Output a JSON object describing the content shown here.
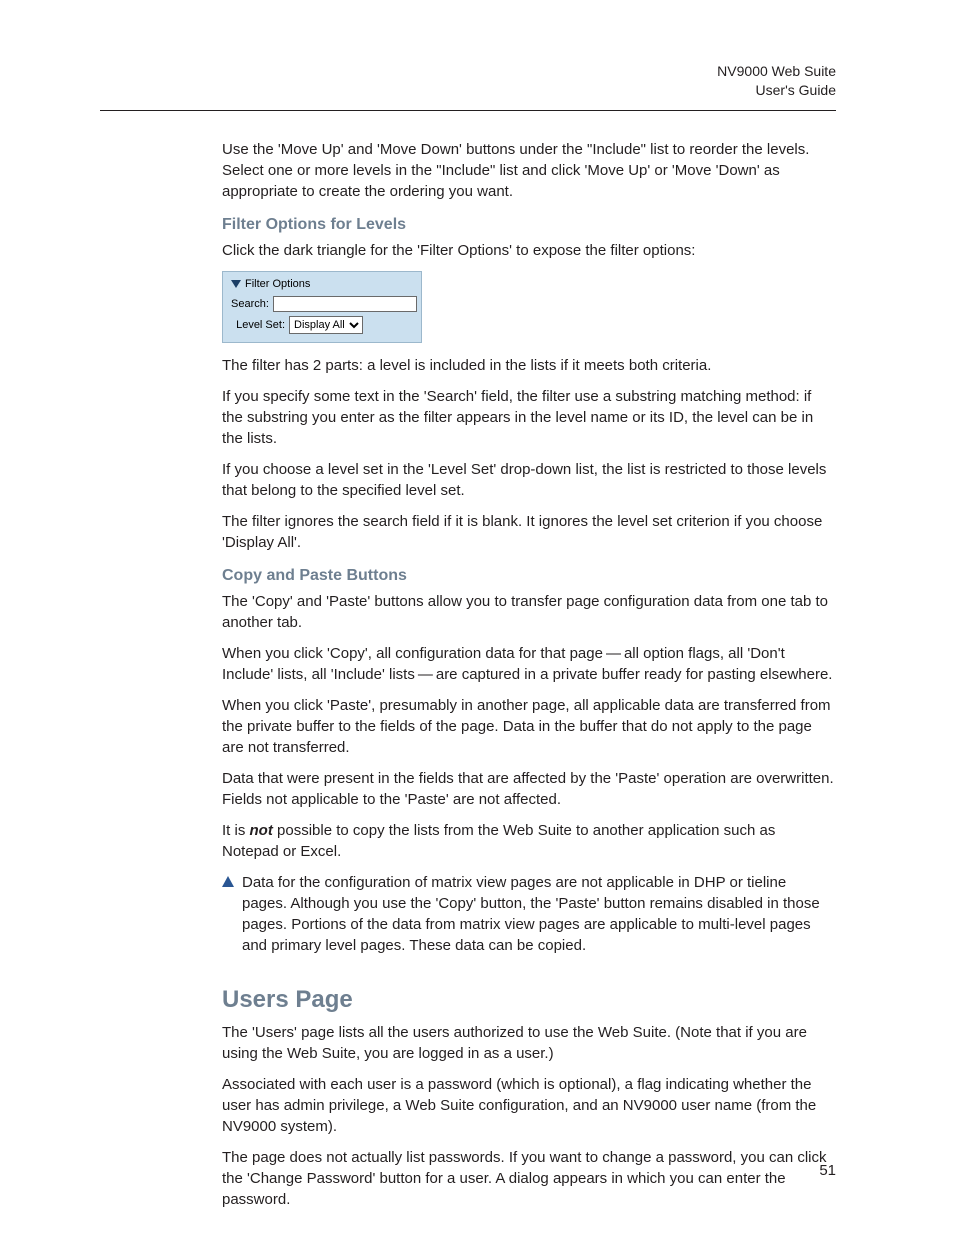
{
  "header": {
    "title": "NV9000 Web Suite",
    "subtitle": "User's Guide"
  },
  "intro_p": "Use the 'Move Up' and 'Move Down' buttons under the \"Include\" list to reorder the levels. Select one or more levels in the \"Include\" list and click 'Move Up' or 'Move 'Down' as appropriate to create the ordering you want.",
  "filter": {
    "heading": "Filter Options for Levels",
    "p1": "Click the dark triangle for the 'Filter Options' to expose the filter options:",
    "panel": {
      "title": "Filter Options",
      "search_label": "Search:",
      "levelset_label": "Level Set:",
      "levelset_value": "Display All"
    },
    "p2": "The filter has 2 parts: a level is included in the lists if it meets both criteria.",
    "p3": "If you specify some text in the 'Search' field, the filter use a substring matching method: if the substring you enter as the filter appears in the level name or its ID, the level can be in the lists.",
    "p4": "If you choose a level set in the 'Level Set' drop-down list, the list is restricted to those levels that belong to the specified level set.",
    "p5": "The filter ignores the search field if it is blank. It ignores the level set criterion if you choose 'Display All'."
  },
  "copy": {
    "heading": "Copy and Paste Buttons",
    "p1": "The 'Copy' and 'Paste' buttons allow you to transfer page configuration data from one tab to another tab.",
    "p2": "When you click 'Copy', all configuration data for that page — all option flags, all 'Don't Include' lists, all 'Include' lists — are captured in a private buffer ready for pasting elsewhere.",
    "p3": "When you click 'Paste', presumably in another page, all applicable data are transferred from the private buffer to the fields of the page. Data in the buffer that do not apply to the page are not transferred.",
    "p4": "Data that were present in the fields that are affected by the 'Paste' operation are overwritten. Fields not applicable to the 'Paste' are not affected.",
    "p5_pre": "It is ",
    "p5_em": "not",
    "p5_post": " possible to copy the lists from the Web Suite to another application such as Notepad or Excel.",
    "note": "Data for the configuration of matrix view pages are not applicable in DHP or tieline pages. Although you use the 'Copy' button, the 'Paste' button remains disabled in those pages. Portions of the data from matrix view pages are applicable to multi-level pages and primary level pages. These data can be copied."
  },
  "users": {
    "heading": "Users Page",
    "p1": "The 'Users' page lists all the users authorized to use the Web Suite. (Note that if you are using the Web Suite, you are logged in as a user.)",
    "p2": "Associated with each user is a password (which is optional), a flag indicating whether the user has admin privilege, a Web Suite configuration, and an NV9000 user name (from the NV9000 system).",
    "p3": "The page does not actually list passwords. If you want to change a password, you can click the 'Change Password' button for a user. A dialog appears in which you can enter the password."
  },
  "page_number": "51"
}
